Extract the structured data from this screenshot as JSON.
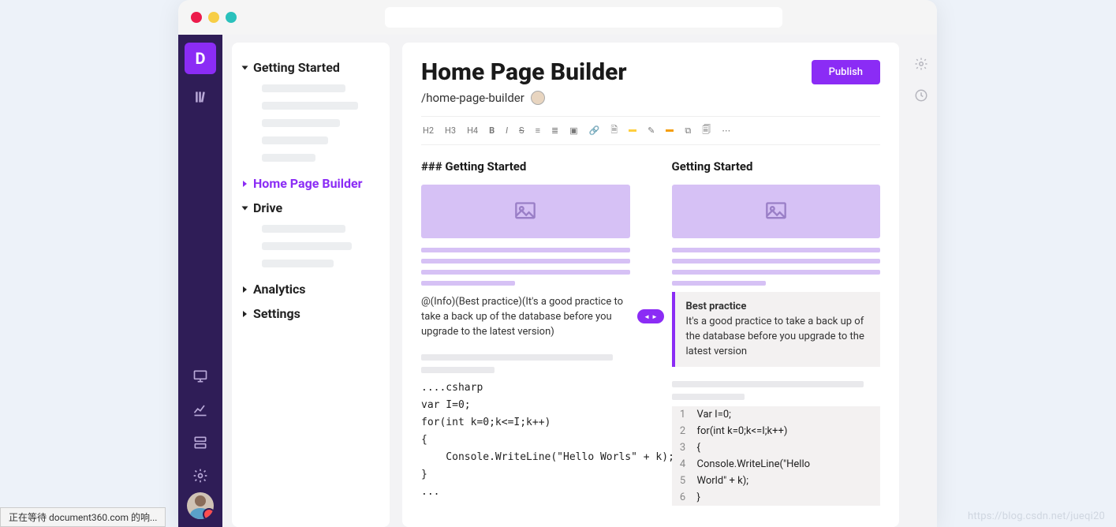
{
  "sidebar": {
    "items": [
      {
        "label": "Getting Started",
        "expanded": true
      },
      {
        "label": "Home Page Builder",
        "expanded": false,
        "active": true
      },
      {
        "label": "Drive",
        "expanded": true
      },
      {
        "label": "Analytics",
        "expanded": false
      },
      {
        "label": "Settings",
        "expanded": false
      }
    ]
  },
  "page": {
    "title": "Home Page Builder",
    "slug": "/home-page-builder",
    "publish_label": "Publish"
  },
  "toolbar": {
    "h2": "H2",
    "h3": "H3",
    "h4": "H4",
    "bold": "B",
    "italic": "I",
    "strike": "S",
    "ul": "≡",
    "ol": "≣",
    "img": "▣",
    "link": "🔗",
    "doc": "🗎",
    "pen": "✎",
    "more": "⋯",
    "copy": "⧉",
    "paste": "🗐"
  },
  "editor": {
    "left": {
      "heading": "### Getting Started",
      "info_raw": "@(Info)(Best practice)(It's a good practice to take a back up of the database before you upgrade to the latest version)",
      "code": "....csharp\nvar I=0;\nfor(int k=0;k<=I;k++)\n{\n    Console.WriteLine(\"Hello Worls\" + k);\n}\n..."
    },
    "right": {
      "heading": "Getting Started",
      "callout_title": "Best practice",
      "callout_body": "It's a good practice to take a back up of the database before you upgrade to the latest version",
      "code_lines": [
        "Var I=0;",
        "for(int k=0;k<=I;k++)",
        "{",
        "  Console.WriteLine(\"Hello",
        "World\" + k);",
        "}"
      ]
    }
  },
  "status_bar": "正在等待 document360.com 的响...",
  "watermark": "https://blog.csdn.net/jueqi20"
}
